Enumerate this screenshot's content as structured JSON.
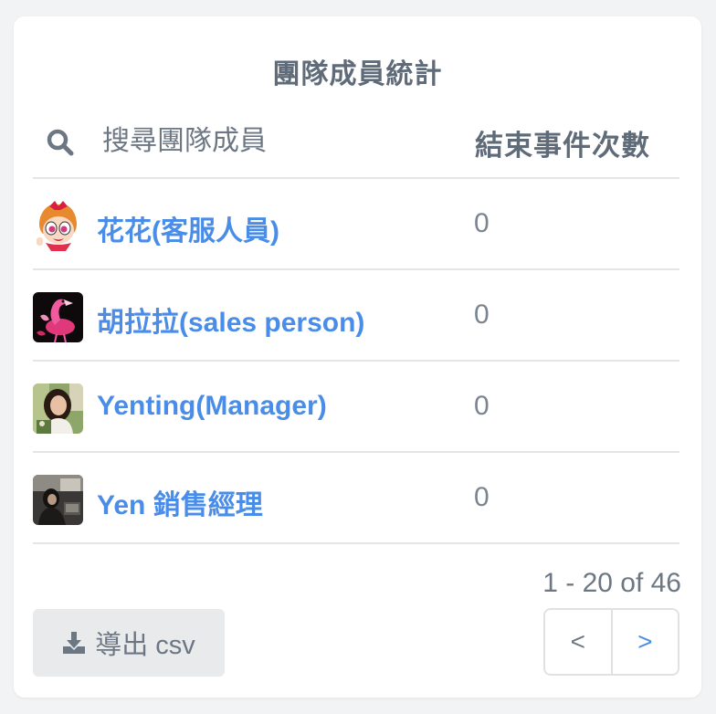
{
  "card": {
    "title": "團隊成員統計"
  },
  "search": {
    "placeholder": "搜尋團隊成員"
  },
  "table": {
    "count_header": "結束事件次數",
    "rows": [
      {
        "name": "花花(客服人員)",
        "count": "0",
        "avatar": "cartoon-girl-avatar"
      },
      {
        "name": "胡拉拉(sales person)",
        "count": "0",
        "avatar": "pink-flamingo-avatar"
      },
      {
        "name": "Yenting(Manager)",
        "count": "0",
        "avatar": "woman-photo-avatar"
      },
      {
        "name": "Yen 銷售經理",
        "count": "0",
        "avatar": "office-photo-avatar"
      }
    ]
  },
  "pagination": {
    "info": "1 - 20 of 46",
    "prev_label": "<",
    "next_label": ">"
  },
  "export": {
    "label": "導出 csv",
    "icon": "download-icon"
  },
  "colors": {
    "link": "#4a8de8",
    "text": "#5f6b78",
    "divider": "#e3e6e9",
    "button_bg": "#e8eaec"
  }
}
